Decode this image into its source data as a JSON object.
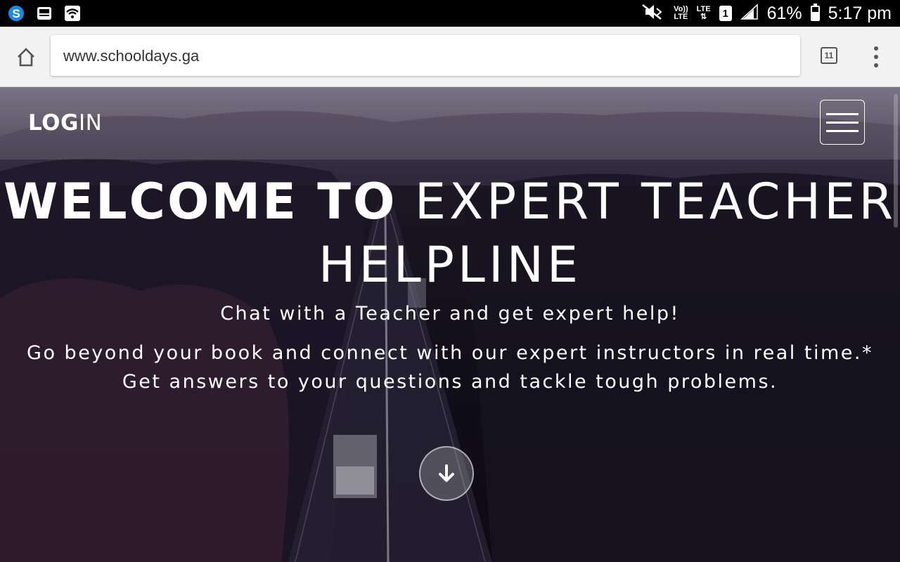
{
  "status_bar": {
    "network_label_top": "Vo))",
    "network_label_bottom": "LTE",
    "lte_label": "LTE",
    "sim_number": "1",
    "battery_percent": "61%",
    "battery_level": 0.61,
    "time": "5:17 pm",
    "icons": [
      "skype-icon",
      "inbox-icon",
      "wifi-icon",
      "mute-icon",
      "signal-icon",
      "battery-icon"
    ]
  },
  "browser": {
    "url": "www.schooldays.ga",
    "tab_count": "11"
  },
  "page": {
    "nav": {
      "login_part1": "LOG",
      "login_part2": "IN"
    },
    "hero": {
      "title_bold": "WELCOME TO",
      "title_light": "EXPERT TEACHER HELPLINE",
      "subtitle": "Chat with a Teacher and get expert help!",
      "description": "Go beyond your book and connect with our expert instructors in real time.* Get answers to your questions and tackle tough problems."
    }
  }
}
